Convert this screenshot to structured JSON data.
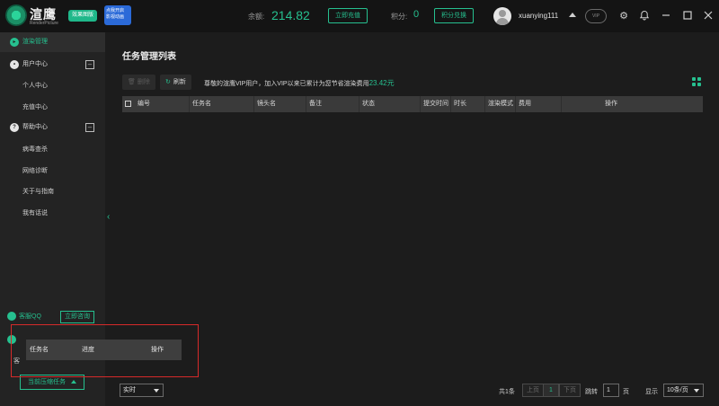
{
  "app": {
    "brand_name": "渲鹰",
    "brand_sub": "RenderPicture",
    "edition_badge": "效果图版",
    "promo_badge": "点我开启 影视动画"
  },
  "header": {
    "balance_label": "余额:",
    "balance_value": "214.82",
    "recharge_button": "立即充值",
    "points_label": "积分:",
    "points_value": "0",
    "redeem_button": "积分兑换",
    "username": "xuanying111",
    "vip_emblem_text": "VIP"
  },
  "sidebar": {
    "render_manage": "渲染管理",
    "user_center": "用户中心",
    "personal_center": "个人中心",
    "recharge_center": "充值中心",
    "help_center": "帮助中心",
    "virus_scan": "病毒查杀",
    "network_diag": "网络诊断",
    "about_guide": "关于与指南",
    "my_talk": "我有话说",
    "qq_service": "客服QQ",
    "consult_now": "立即咨询",
    "partial_label": "客",
    "queue_button": "当前压缩任务"
  },
  "main": {
    "title": "任务管理列表",
    "delete_button": "删除",
    "refresh_button": "刷新",
    "vip_notice_prefix": "尊敬的渲鹰VIP用户，加入VIP以来已累计为您节省渲染费用",
    "vip_saved_amount": "23.42元",
    "columns": [
      "编号",
      "任务名",
      "镜头名",
      "备注",
      "状态",
      "提交时间",
      "时长",
      "渲染模式",
      "费用",
      "操作"
    ]
  },
  "queue_popup": {
    "col_name": "任务名",
    "col_progress": "进度",
    "col_action": "操作"
  },
  "footer": {
    "mode_select": "实时",
    "total": "共1条",
    "prev": "上页",
    "current_page": "1",
    "next": "下页",
    "jump_label": "跳转",
    "jump_value": "1",
    "page_unit": "页",
    "display_label": "显示",
    "per_page": "10条/页"
  },
  "colors": {
    "accent": "#26c08f",
    "frame_red": "#d62a2a"
  }
}
